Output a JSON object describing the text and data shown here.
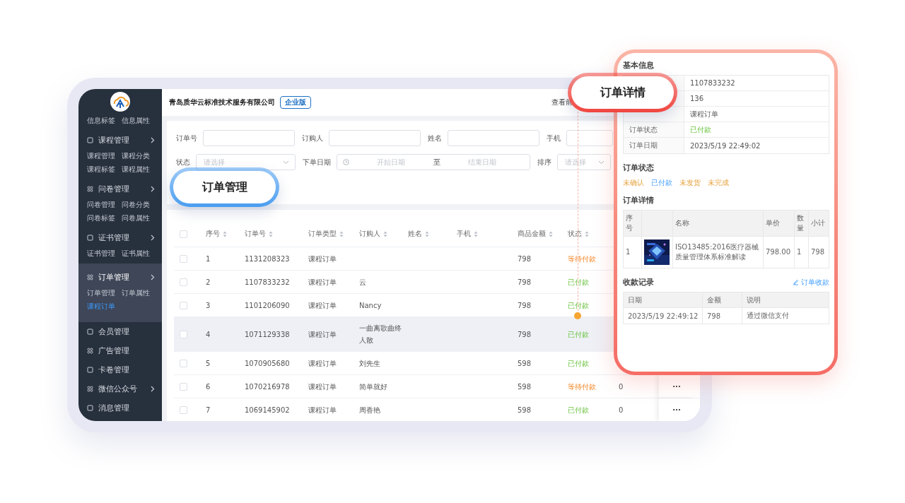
{
  "sidebar": {
    "top_links": [
      {
        "label": "信息标签",
        "selected": false
      },
      {
        "label": "信息属性",
        "selected": false
      }
    ],
    "groups": [
      {
        "label": "课程管理",
        "expandable": true,
        "selected": false,
        "children": [
          {
            "label": "课程管理",
            "selected": false
          },
          {
            "label": "课程分类",
            "selected": false
          },
          {
            "label": "课程标签",
            "selected": false
          },
          {
            "label": "课程属性",
            "selected": false
          }
        ]
      },
      {
        "label": "问卷管理",
        "expandable": true,
        "selected": false,
        "children": [
          {
            "label": "问卷管理",
            "selected": false
          },
          {
            "label": "问卷分类",
            "selected": false
          },
          {
            "label": "问卷标签",
            "selected": false
          },
          {
            "label": "问卷属性",
            "selected": false
          }
        ]
      },
      {
        "label": "证书管理",
        "expandable": true,
        "selected": false,
        "children": [
          {
            "label": "证书管理",
            "selected": false
          },
          {
            "label": "证书属性",
            "selected": false
          }
        ]
      },
      {
        "label": "订单管理",
        "expandable": true,
        "selected": true,
        "children": [
          {
            "label": "订单管理",
            "selected": false
          },
          {
            "label": "订单属性",
            "selected": false
          },
          {
            "label": "课程订单",
            "selected": true
          }
        ]
      },
      {
        "label": "会员管理",
        "expandable": false,
        "selected": false
      },
      {
        "label": "广告管理",
        "expandable": false,
        "selected": false
      },
      {
        "label": "卡卷管理",
        "expandable": false,
        "selected": false
      },
      {
        "label": "微信公众号",
        "expandable": true,
        "selected": false
      },
      {
        "label": "消息管理",
        "expandable": false,
        "selected": false
      }
    ]
  },
  "header": {
    "company": "青岛质华云标准技术服务有限公司",
    "edition_badge": "企业版",
    "link": "查看前"
  },
  "filter_rows": [
    [
      {
        "kind": "input",
        "label": "订单号"
      },
      {
        "kind": "input",
        "label": "订购人"
      },
      {
        "kind": "input",
        "label": "姓名"
      },
      {
        "kind": "input",
        "label": "手机"
      }
    ],
    [
      {
        "kind": "select",
        "label": "状态",
        "placeholder": "请选择"
      },
      {
        "kind": "daterange",
        "label": "下单日期",
        "start_placeholder": "开始日期",
        "separator": "至",
        "end_placeholder": "结束日期"
      },
      {
        "kind": "select",
        "label": "排序",
        "placeholder": "请选择"
      }
    ]
  ],
  "table": {
    "select_all_checked": false,
    "columns": [
      "序号",
      "订单号",
      "订单类型",
      "订购人",
      "姓名",
      "手机",
      "商品金额",
      "状态"
    ],
    "rows": [
      {
        "no": "1",
        "order_no": "1131208323",
        "type": "课程订单",
        "buyer": "",
        "amount": "798",
        "status": "等待付款",
        "paid": false,
        "highlighted": false,
        "checked": false
      },
      {
        "no": "2",
        "order_no": "1107833232",
        "type": "课程订单",
        "buyer": "云",
        "amount": "798",
        "status": "已付款",
        "paid": true,
        "highlighted": false,
        "checked": false
      },
      {
        "no": "3",
        "order_no": "1101206090",
        "type": "课程订单",
        "buyer": "Nancy",
        "amount": "798",
        "status": "已付款",
        "paid": true,
        "highlighted": false,
        "checked": false
      },
      {
        "no": "4",
        "order_no": "1071129338",
        "type": "课程订单",
        "buyer": "一曲离歌曲终人散",
        "amount": "798",
        "status": "已付款",
        "paid": true,
        "highlighted": true,
        "checked": false
      },
      {
        "no": "5",
        "order_no": "1070905680",
        "type": "课程订单",
        "buyer": "刘先生",
        "amount": "598",
        "status": "已付款",
        "paid": true,
        "highlighted": false,
        "checked": false
      },
      {
        "no": "6",
        "order_no": "1070216978",
        "type": "课程订单",
        "buyer": "简单就好",
        "amount": "598",
        "status": "等待付款",
        "paid": false,
        "highlighted": false,
        "checked": false,
        "column_10": "0",
        "actions": "···"
      },
      {
        "no": "7",
        "order_no": "1069145902",
        "type": "课程订单",
        "buyer": "周香艳",
        "amount": "598",
        "status": "已付款",
        "paid": true,
        "highlighted": false,
        "checked": false,
        "column_10": "0",
        "actions": "···"
      }
    ]
  },
  "callouts": [
    {
      "label": "订单管理",
      "color": "#4a9df0"
    },
    {
      "label": "订单详情",
      "color": "#f0453f"
    }
  ],
  "detail": {
    "basic_title": "基本信息",
    "basic_rows": [
      {
        "value": "1107833232",
        "kind": "text"
      },
      {
        "value": "136",
        "kind": "text"
      },
      {
        "value": "课程订单",
        "kind": "text"
      },
      {
        "label": "订单状态",
        "value": "已付款",
        "kind": "status"
      },
      {
        "label": "订单日期",
        "value": "2023/5/19 22:49:02",
        "kind": "text"
      }
    ],
    "status_title": "订单状态",
    "steps": [
      {
        "label": "未确认",
        "selected": false
      },
      {
        "label": "已付款",
        "selected": true
      },
      {
        "label": "未发货",
        "selected": false
      },
      {
        "label": "未完成",
        "selected": false
      }
    ],
    "items_title": "订单详情",
    "items_columns": [
      "序号",
      "",
      "名称",
      "单价",
      "数量",
      "小计"
    ],
    "items": [
      {
        "no": "1",
        "name": "ISO13485:2016医疗器械质量管理体系标准解读",
        "price": "798.00",
        "qty": "1",
        "subtotal": "798"
      }
    ],
    "payments_title": "收款记录",
    "payments_link": "订单收款",
    "payments_columns": [
      "日期",
      "金额",
      "说明"
    ],
    "payments": [
      {
        "date": "2023/5/19 22:49:12",
        "amount": "798",
        "note": "通过微信支付"
      }
    ]
  }
}
